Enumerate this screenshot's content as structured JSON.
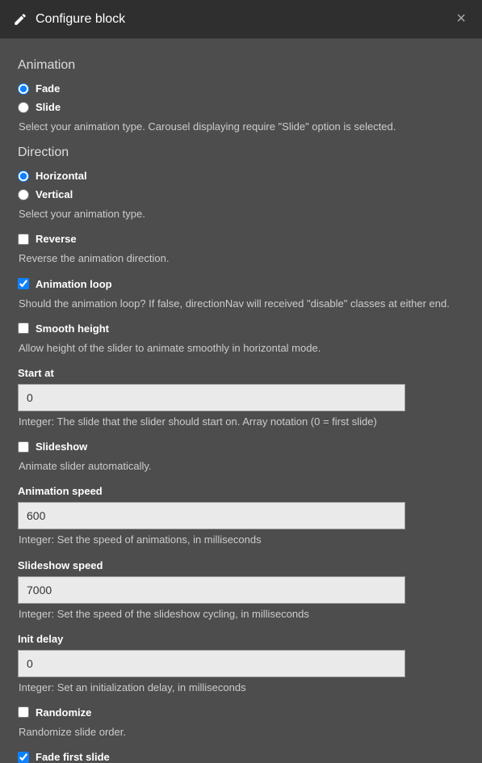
{
  "header": {
    "title": "Configure block",
    "close": "×"
  },
  "animation": {
    "heading": "Animation",
    "options": {
      "fade": "Fade",
      "slide": "Slide"
    },
    "selected": "fade",
    "desc": "Select your animation type. Carousel displaying require \"Slide\" option is selected."
  },
  "direction": {
    "heading": "Direction",
    "options": {
      "horizontal": "Horizontal",
      "vertical": "Vertical"
    },
    "selected": "horizontal",
    "desc": "Select your animation type."
  },
  "reverse": {
    "label": "Reverse",
    "checked": false,
    "desc": "Reverse the animation direction."
  },
  "loop": {
    "label": "Animation loop",
    "checked": true,
    "desc": "Should the animation loop? If false, directionNav will received \"disable\" classes at either end."
  },
  "smooth": {
    "label": "Smooth height",
    "checked": false,
    "desc": "Allow height of the slider to animate smoothly in horizontal mode."
  },
  "start_at": {
    "label": "Start at",
    "value": "0",
    "desc": "Integer: The slide that the slider should start on. Array notation (0 = first slide)"
  },
  "slideshow": {
    "label": "Slideshow",
    "checked": false,
    "desc": "Animate slider automatically."
  },
  "anim_speed": {
    "label": "Animation speed",
    "value": "600",
    "desc": "Integer: Set the speed of animations, in milliseconds"
  },
  "slide_speed": {
    "label": "Slideshow speed",
    "value": "7000",
    "desc": "Integer: Set the speed of the slideshow cycling, in milliseconds"
  },
  "init_delay": {
    "label": "Init delay",
    "value": "0",
    "desc": "Integer: Set an initialization delay, in milliseconds"
  },
  "randomize": {
    "label": "Randomize",
    "checked": false,
    "desc": "Randomize slide order."
  },
  "fade_first": {
    "label": "Fade first slide",
    "checked": true
  }
}
